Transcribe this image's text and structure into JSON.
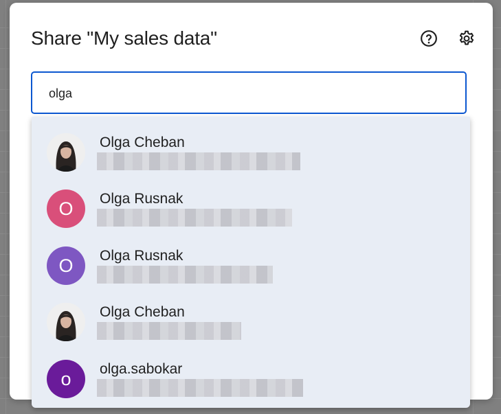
{
  "dialog": {
    "title": "Share \"My sales data\"",
    "help_icon": "help-circle-icon",
    "settings_icon": "gear-icon"
  },
  "search": {
    "value": "olga"
  },
  "suggestions": [
    {
      "name": "Olga Cheban",
      "avatar": "photo",
      "avatar_color": "#ececec"
    },
    {
      "name": "Olga Rusnak",
      "avatar": "O",
      "avatar_color": "#d94f7a"
    },
    {
      "name": "Olga Rusnak",
      "avatar": "O",
      "avatar_color": "#7e57c2"
    },
    {
      "name": "Olga Cheban",
      "avatar": "photo",
      "avatar_color": "#ececec"
    },
    {
      "name": "olga.sabokar",
      "avatar": "o",
      "avatar_color": "#6a1b9a"
    }
  ],
  "colors": {
    "accent": "#0b57d0",
    "dropdown_bg": "#e8edf5"
  }
}
